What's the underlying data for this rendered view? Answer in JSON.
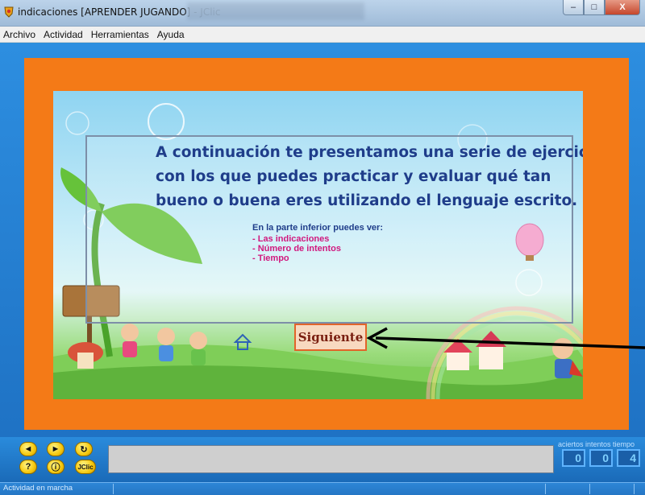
{
  "window": {
    "title": "indicaciones [APRENDER JUGANDO] - JClic",
    "minimize": "–",
    "maximize": "□",
    "close": "X"
  },
  "menu": [
    "Archivo",
    "Actividad",
    "Herramientas",
    "Ayuda"
  ],
  "content": {
    "lines": [
      "A continuación te presentamos una serie de ejercicios",
      "con los que puedes practicar y evaluar qué tan",
      "bueno o buena eres utilizando el lenguaje escrito."
    ],
    "subheading": "En la parte inferior puedes ver:",
    "bullets": [
      "- Las indicaciones",
      "- Número de intentos",
      "- Tiempo"
    ],
    "next_button": "Siguiente"
  },
  "controls": {
    "prev_icon": "◄",
    "next_icon": "►",
    "restart_icon": "↻",
    "help_icon": "?",
    "info_icon": "ⓘ",
    "jclic_label": "JClic"
  },
  "counters": {
    "labels": "aciertos intentos tiempo",
    "aciertos": "0",
    "intentos": "0",
    "tiempo": "4"
  },
  "status": {
    "text": "Actividad en marcha"
  },
  "colors": {
    "accent": "#f47a17",
    "text_blue": "#1f3d8a",
    "bullet_pink": "#d1187e"
  }
}
